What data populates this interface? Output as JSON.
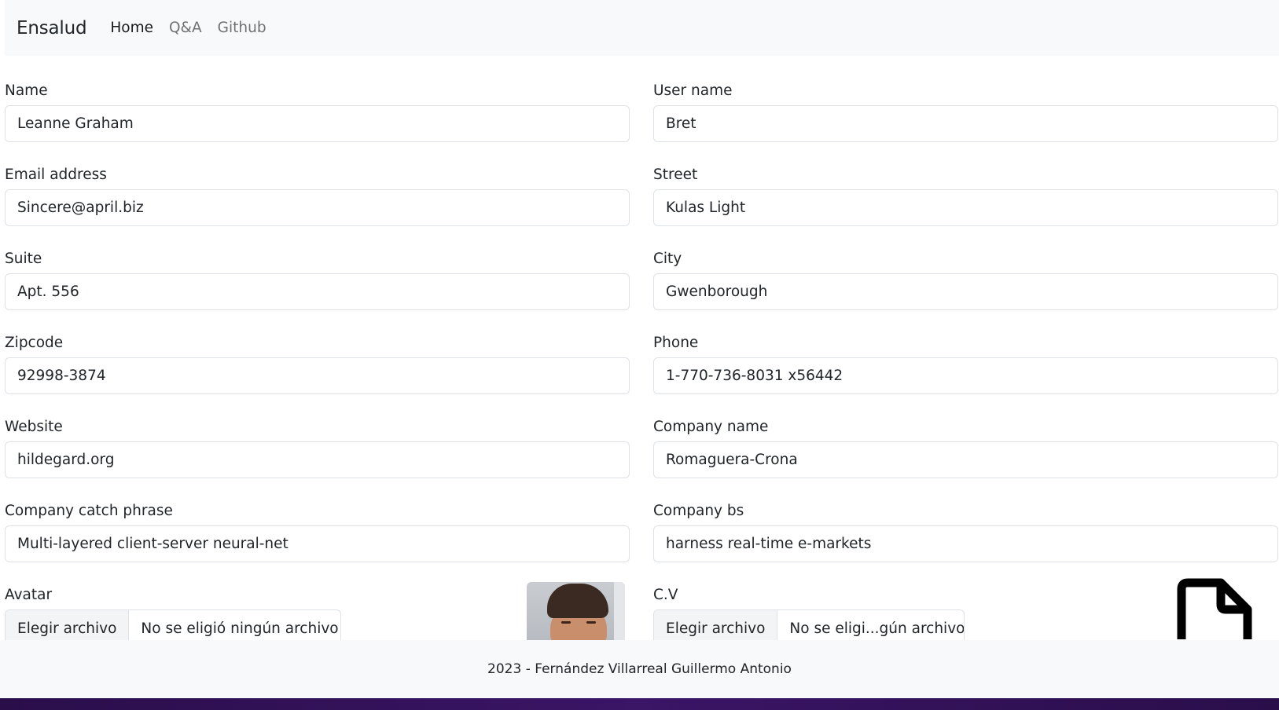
{
  "navbar": {
    "brand": "Ensalud",
    "links": [
      "Home",
      "Q&A",
      "Github"
    ]
  },
  "form": {
    "name": {
      "label": "Name",
      "value": "Leanne Graham"
    },
    "username": {
      "label": "User name",
      "value": "Bret"
    },
    "email": {
      "label": "Email address",
      "value": "Sincere@april.biz"
    },
    "street": {
      "label": "Street",
      "value": "Kulas Light"
    },
    "suite": {
      "label": "Suite",
      "value": "Apt. 556"
    },
    "city": {
      "label": "City",
      "value": "Gwenborough"
    },
    "zipcode": {
      "label": "Zipcode",
      "value": "92998-3874"
    },
    "phone": {
      "label": "Phone",
      "value": "1-770-736-8031 x56442"
    },
    "website": {
      "label": "Website",
      "value": "hildegard.org"
    },
    "company_name": {
      "label": "Company name",
      "value": "Romaguera-Crona"
    },
    "catch_phrase": {
      "label": "Company catch phrase",
      "value": "Multi-layered client-server neural-net"
    },
    "company_bs": {
      "label": "Company bs",
      "value": "harness real-time e-markets"
    },
    "avatar": {
      "label": "Avatar",
      "button": "Elegir archivo",
      "filename": "No se eligió ningún archivo"
    },
    "cv": {
      "label": "C.V",
      "button": "Elegir archivo",
      "filename": "No se eligi...gún archivo"
    }
  },
  "footer": {
    "text": "2023 - Fernández Villarreal Guillermo Antonio"
  },
  "icons": {
    "cv_preview": "file-icon",
    "avatar_preview": "avatar-photo"
  }
}
